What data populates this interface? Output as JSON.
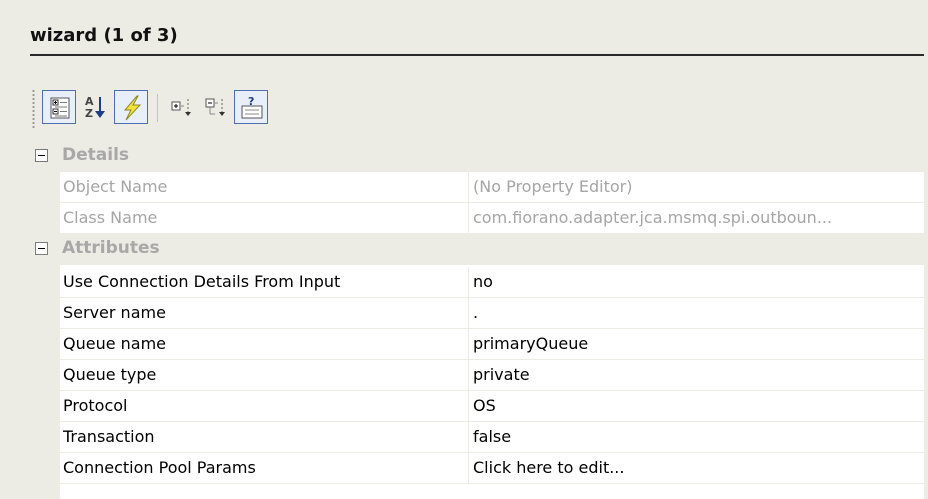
{
  "panel": {
    "title": "wizard (1 of 3)"
  },
  "toolbar": {
    "buttons": [
      {
        "name": "categorized-view",
        "icon": "categorized-icon"
      },
      {
        "name": "alphabetical-view",
        "icon": "sort-az-icon"
      },
      {
        "name": "events-view",
        "icon": "lightning-icon"
      },
      {
        "name": "expand-all",
        "icon": "expand-icon"
      },
      {
        "name": "collapse-all",
        "icon": "collapse-icon"
      },
      {
        "name": "help-view",
        "icon": "help-description-icon"
      }
    ]
  },
  "categories": [
    {
      "label": "Details",
      "rows": [
        {
          "name": "Object Name",
          "value": "(No Property Editor)"
        },
        {
          "name": "Class Name",
          "value": "com.fiorano.adapter.jca.msmq.spi.outboun..."
        }
      ]
    },
    {
      "label": "Attributes",
      "rows": [
        {
          "name": "Use Connection Details From Input",
          "value": "no"
        },
        {
          "name": "Server name",
          "value": "."
        },
        {
          "name": "Queue name",
          "value": "primaryQueue"
        },
        {
          "name": "Queue type",
          "value": "private"
        },
        {
          "name": "Protocol",
          "value": "OS"
        },
        {
          "name": "Transaction",
          "value": "false"
        },
        {
          "name": "Connection Pool Params",
          "value": "Click here to edit..."
        }
      ]
    }
  ],
  "colors": {
    "background": "#ecebe4",
    "disabled_text": "#a5a5a5",
    "accent": "#4b6fb0"
  }
}
